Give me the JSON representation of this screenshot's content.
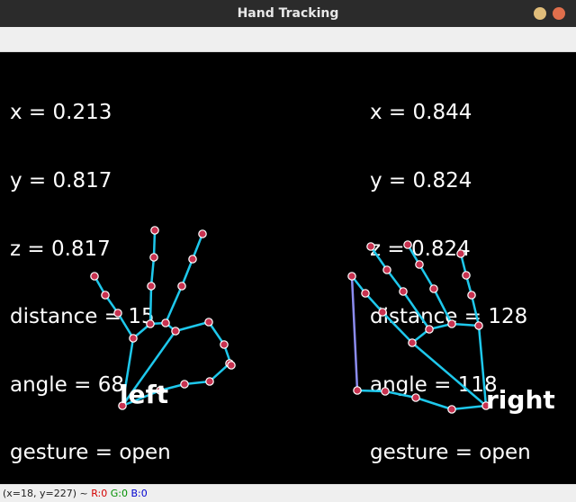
{
  "window": {
    "title": "Hand Tracking"
  },
  "hands": [
    {
      "id": "left",
      "label": "left",
      "stats": [
        "x = 0.213",
        "y = 0.817",
        "z = 0.817",
        "distance = 15",
        "angle = 68",
        "gesture = open"
      ]
    },
    {
      "id": "right",
      "label": "right",
      "stats": [
        "x = 0.844",
        "y = 0.824",
        "z = 0.824",
        "distance = 128",
        "angle = 118",
        "gesture = open"
      ]
    }
  ],
  "status": {
    "coords": "(x=18, y=227) ~ ",
    "r": "R:0",
    "g": "G:0",
    "b": "B:0"
  },
  "colors": {
    "bone": "#1ec8ec",
    "palm_edge": "#8c8cf0",
    "joint_fill": "#c83250",
    "joint_stroke": "#ffffff",
    "text": "#ffffff",
    "background": "#000000"
  }
}
